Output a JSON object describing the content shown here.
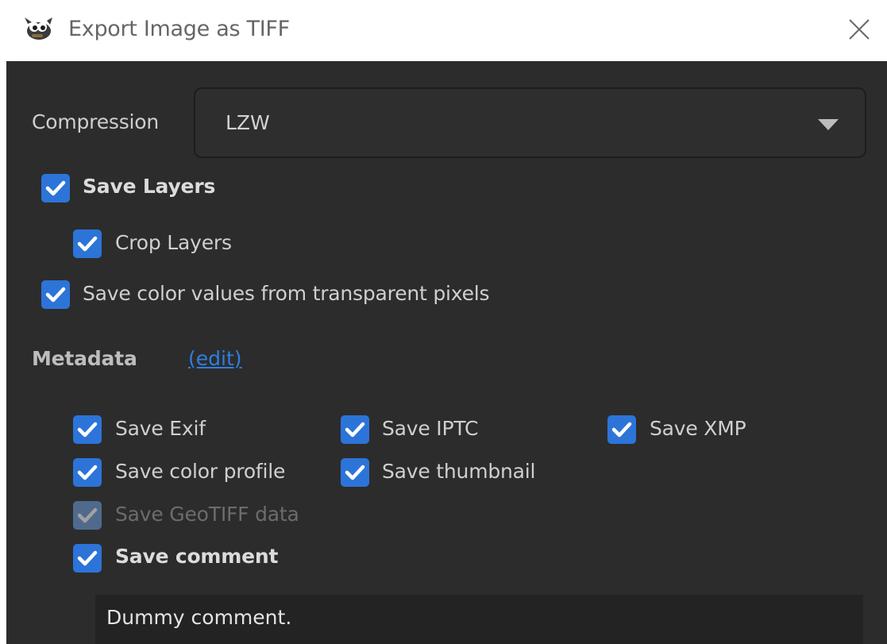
{
  "window": {
    "title": "Export Image as TIFF",
    "app_icon": "gimp-wilber-icon",
    "close_icon": "close-icon"
  },
  "compression": {
    "label": "Compression",
    "value": "LZW",
    "arrow_icon": "chevron-down-icon"
  },
  "options": {
    "save_layers": {
      "label": "Save Layers",
      "checked": true
    },
    "crop_layers": {
      "label": "Crop Layers",
      "checked": true
    },
    "save_transparent": {
      "label": "Save color values from transparent pixels",
      "checked": true
    }
  },
  "metadata": {
    "heading": "Metadata",
    "edit_link": "(edit)",
    "save_exif": {
      "label": "Save Exif",
      "checked": true
    },
    "save_iptc": {
      "label": "Save IPTC",
      "checked": true
    },
    "save_xmp": {
      "label": "Save XMP",
      "checked": true
    },
    "save_color_profile": {
      "label": "Save color profile",
      "checked": true
    },
    "save_thumbnail": {
      "label": "Save thumbnail",
      "checked": true
    },
    "save_geotiff": {
      "label": "Save GeoTIFF data",
      "checked": true,
      "enabled": false
    },
    "save_comment": {
      "label": "Save comment",
      "checked": true
    }
  },
  "comment": {
    "value": "Dummy comment."
  },
  "colors": {
    "background": "#2c2c2c",
    "accent": "#2d74d8",
    "link": "#2f7ee0",
    "titlebar": "#ffffff"
  }
}
